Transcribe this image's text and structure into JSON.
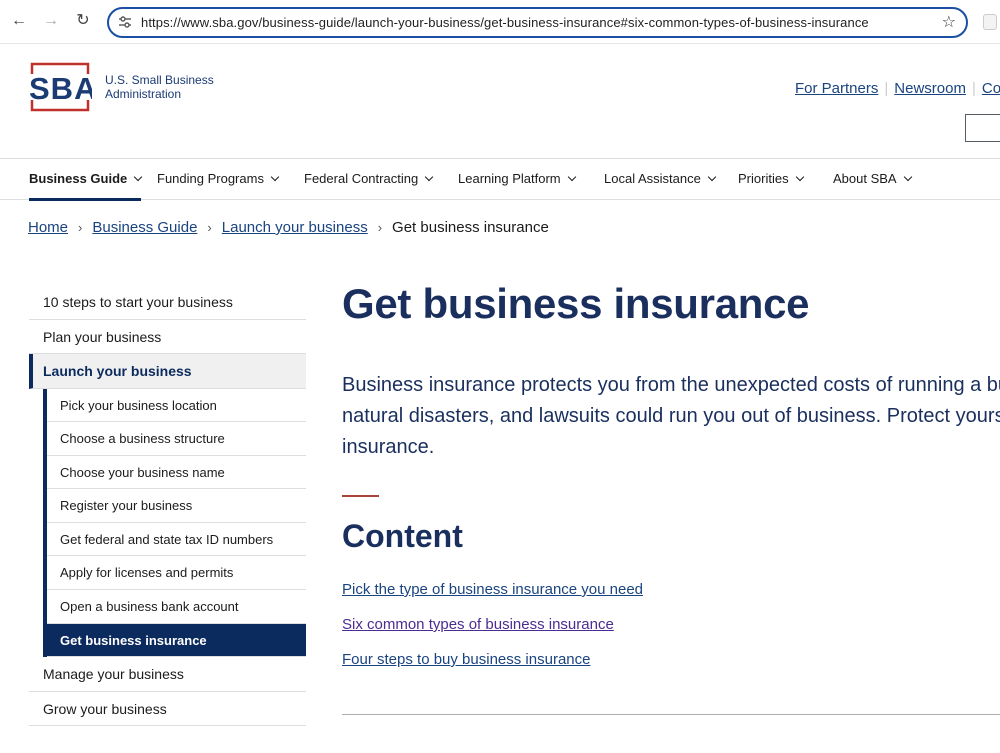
{
  "browser": {
    "url": "https://www.sba.gov/business-guide/launch-your-business/get-business-insurance#six-common-types-of-business-insurance"
  },
  "header": {
    "logo_text": "SBA",
    "agency_line1": "U.S. Small Business",
    "agency_line2": "Administration",
    "util_links": [
      "For Partners",
      "Newsroom",
      "Co"
    ]
  },
  "mainnav": [
    {
      "label": "Business Guide",
      "active": true
    },
    {
      "label": "Funding Programs"
    },
    {
      "label": "Federal Contracting"
    },
    {
      "label": "Learning Platform"
    },
    {
      "label": "Local Assistance"
    },
    {
      "label": "Priorities"
    },
    {
      "label": "About SBA"
    }
  ],
  "breadcrumb": {
    "items": [
      "Home",
      "Business Guide",
      "Launch your business"
    ],
    "current": "Get business insurance"
  },
  "sidenav": {
    "top": [
      "10 steps to start your business",
      "Plan your business"
    ],
    "section": "Launch your business",
    "sub": [
      "Pick your business location",
      "Choose a business structure",
      "Choose your business name",
      "Register your business",
      "Get federal and state tax ID numbers",
      "Apply for licenses and permits",
      "Open a business bank account",
      "Get business insurance"
    ],
    "bottom": [
      "Manage your business",
      "Grow your business"
    ]
  },
  "content": {
    "title": "Get business insurance",
    "intro_lines": [
      "Business insurance protects you from the unexpected costs of running a busi",
      "natural disasters, and lawsuits could run you out of business. Protect yoursel",
      "insurance."
    ],
    "toc_heading": "Content",
    "toc": [
      "Pick the type of business insurance you need",
      "Six common types of business insurance",
      "Four steps to buy business insurance"
    ]
  },
  "colors": {
    "navy": "#0b2a5e",
    "heading": "#1a2f5e",
    "link": "#1a4480",
    "visited": "#4c2c92",
    "accent_red": "#a94538"
  }
}
